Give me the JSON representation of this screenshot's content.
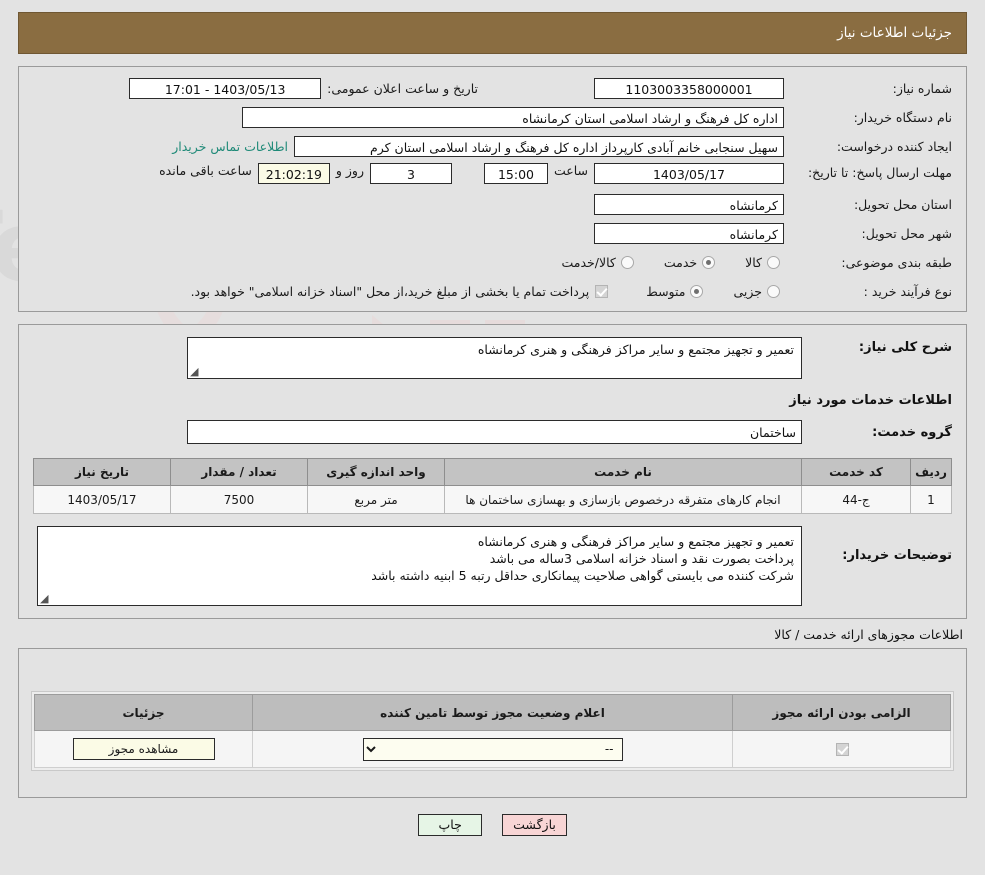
{
  "header": {
    "title": "جزئیات اطلاعات نیاز",
    "bg_color": "#8a6d41"
  },
  "top_form": {
    "need_number_label": "شماره نیاز:",
    "need_number_value": "1103003358000001",
    "announce_label": "تاریخ و ساعت اعلان عمومی:",
    "announce_value": "1403/05/13 - 17:01",
    "buyer_org_label": "نام دستگاه خریدار:",
    "buyer_org_value": "اداره کل فرهنگ و ارشاد اسلامی استان کرمانشاه",
    "creator_label": "ایجاد کننده درخواست:",
    "creator_value": "سهیل سنجابی خانم آبادی کارپرداز اداره کل فرهنگ و ارشاد اسلامی استان کرم",
    "contact_link": "اطلاعات تماس خریدار",
    "deadline_label": "مهلت ارسال پاسخ: تا تاریخ:",
    "deadline_date": "1403/05/17",
    "time_label": "ساعت",
    "deadline_time": "15:00",
    "days_remaining": "3",
    "days_label": "روز و",
    "countdown": "21:02:19",
    "countdown_label": "ساعت باقی مانده",
    "province_label": "استان محل تحویل:",
    "province_value": "کرمانشاه",
    "city_label": "شهر محل تحویل:",
    "city_value": "کرمانشاه",
    "category_label": "طبقه بندی موضوعی:",
    "category_options": [
      {
        "label": "کالا",
        "selected": false
      },
      {
        "label": "خدمت",
        "selected": true
      },
      {
        "label": "کالا/خدمت",
        "selected": false
      }
    ],
    "process_label": "نوع فرآیند خرید :",
    "process_options": [
      {
        "label": "جزیی",
        "selected": false
      },
      {
        "label": "متوسط",
        "selected": true
      }
    ],
    "treasury_checked": true,
    "treasury_note": "پرداخت تمام یا بخشی از مبلغ خرید،از محل \"اسناد خزانه اسلامی\" خواهد بود."
  },
  "need_desc": {
    "label": "شرح کلی نیاز:",
    "value": "تعمیر و تجهیز مجتمع و سایر مراکز فرهنگی و هنری کرمانشاه"
  },
  "services": {
    "section_title": "اطلاعات خدمات مورد نیاز",
    "group_label": "گروه خدمت:",
    "group_value": "ساختمان",
    "columns": [
      "ردیف",
      "کد خدمت",
      "نام خدمت",
      "واحد اندازه گیری",
      "تعداد / مقدار",
      "تاریخ نیاز"
    ],
    "rows": [
      {
        "row": "1",
        "code": "ج-44",
        "name": "انجام کارهای متفرقه درخصوص بازسازی و بهسازی ساختمان ها",
        "unit": "متر مربع",
        "qty": "7500",
        "date": "1403/05/17"
      }
    ]
  },
  "buyer_notes": {
    "label": "توضیحات خریدار:",
    "lines": [
      "تعمیر و تجهیز مجتمع و سایر مراکز فرهنگی و هنری کرمانشاه",
      "پرداخت بصورت نقد و اسناد خزانه اسلامی 3ساله می باشد",
      "شرکت کننده می بایستی گواهی صلاحیت پیمانکاری حداقل رتبه 5 ابنیه داشته باشد"
    ]
  },
  "permits": {
    "section_title": "اطلاعات مجوزهای ارائه خدمت / کالا",
    "columns": [
      "الزامی بودن ارائه مجوز",
      "اعلام وضعیت مجوز توسط تامین کننده",
      "جزئیات"
    ],
    "rows": [
      {
        "required_checked": true,
        "status_value": "--",
        "status_options": [
          "--"
        ],
        "details_button": "مشاهده مجوز"
      }
    ]
  },
  "footer": {
    "print_label": "چاپ",
    "back_label": "بازگشت"
  },
  "watermark": {
    "text": "AriaTender.net"
  }
}
